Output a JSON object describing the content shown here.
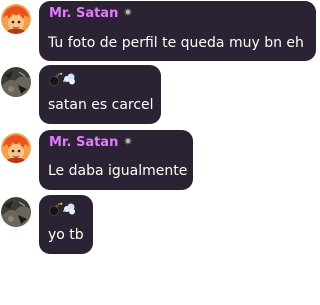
{
  "colors": {
    "bubble_bg": "#2b2233",
    "username": "#e27bff",
    "message_text": "#ffffff",
    "badge": "#bfbfbf",
    "page_bg": "#ffffff"
  },
  "messages": [
    {
      "author": "Mr. Satan",
      "badge_icon": "star-badge-icon",
      "badge_glyph": "✷",
      "avatar_icon": "orange-haired-character-avatar",
      "text": "Tu foto de perfil te queda muy bn eh"
    },
    {
      "author_icons": [
        "bomb-icon",
        "dash-icon"
      ],
      "avatar_icon": "dark-profile-photo-avatar",
      "text": "satan es carcel"
    },
    {
      "author": "Mr. Satan",
      "badge_icon": "star-badge-icon",
      "badge_glyph": "✷",
      "avatar_icon": "orange-haired-character-avatar",
      "text": "Le daba igualmente"
    },
    {
      "author_icons": [
        "bomb-icon",
        "dash-icon"
      ],
      "avatar_icon": "dark-profile-photo-avatar",
      "text": "yo tb"
    }
  ]
}
